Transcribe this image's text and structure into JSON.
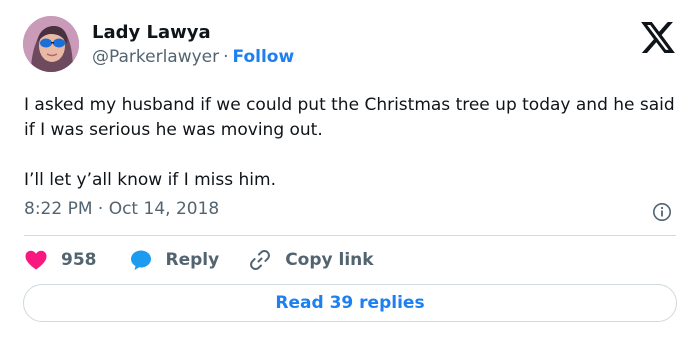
{
  "author": {
    "name": "Lady Lawya",
    "handle": "@Parkerlawyer",
    "separator": "·",
    "follow_label": "Follow"
  },
  "tweet": {
    "line1": "I asked my husband if we could put the Christmas tree up today and he said if I was serious he was moving out.",
    "line2": "I’ll let y’all know if I miss him."
  },
  "timestamp": "8:22 PM · Oct 14, 2018",
  "actions": {
    "likes": "958",
    "reply_label": "Reply",
    "copy_label": "Copy link"
  },
  "replies_button": "Read 39 replies",
  "colors": {
    "accent": "#1d7ff0",
    "heart": "#f91880",
    "reply_bubble": "#1d9bf0",
    "muted": "#536471",
    "border": "#cfd9de"
  },
  "icons": [
    "avatar-photo",
    "x-logo-icon",
    "info-icon",
    "heart-icon",
    "reply-bubble-icon",
    "link-icon"
  ]
}
